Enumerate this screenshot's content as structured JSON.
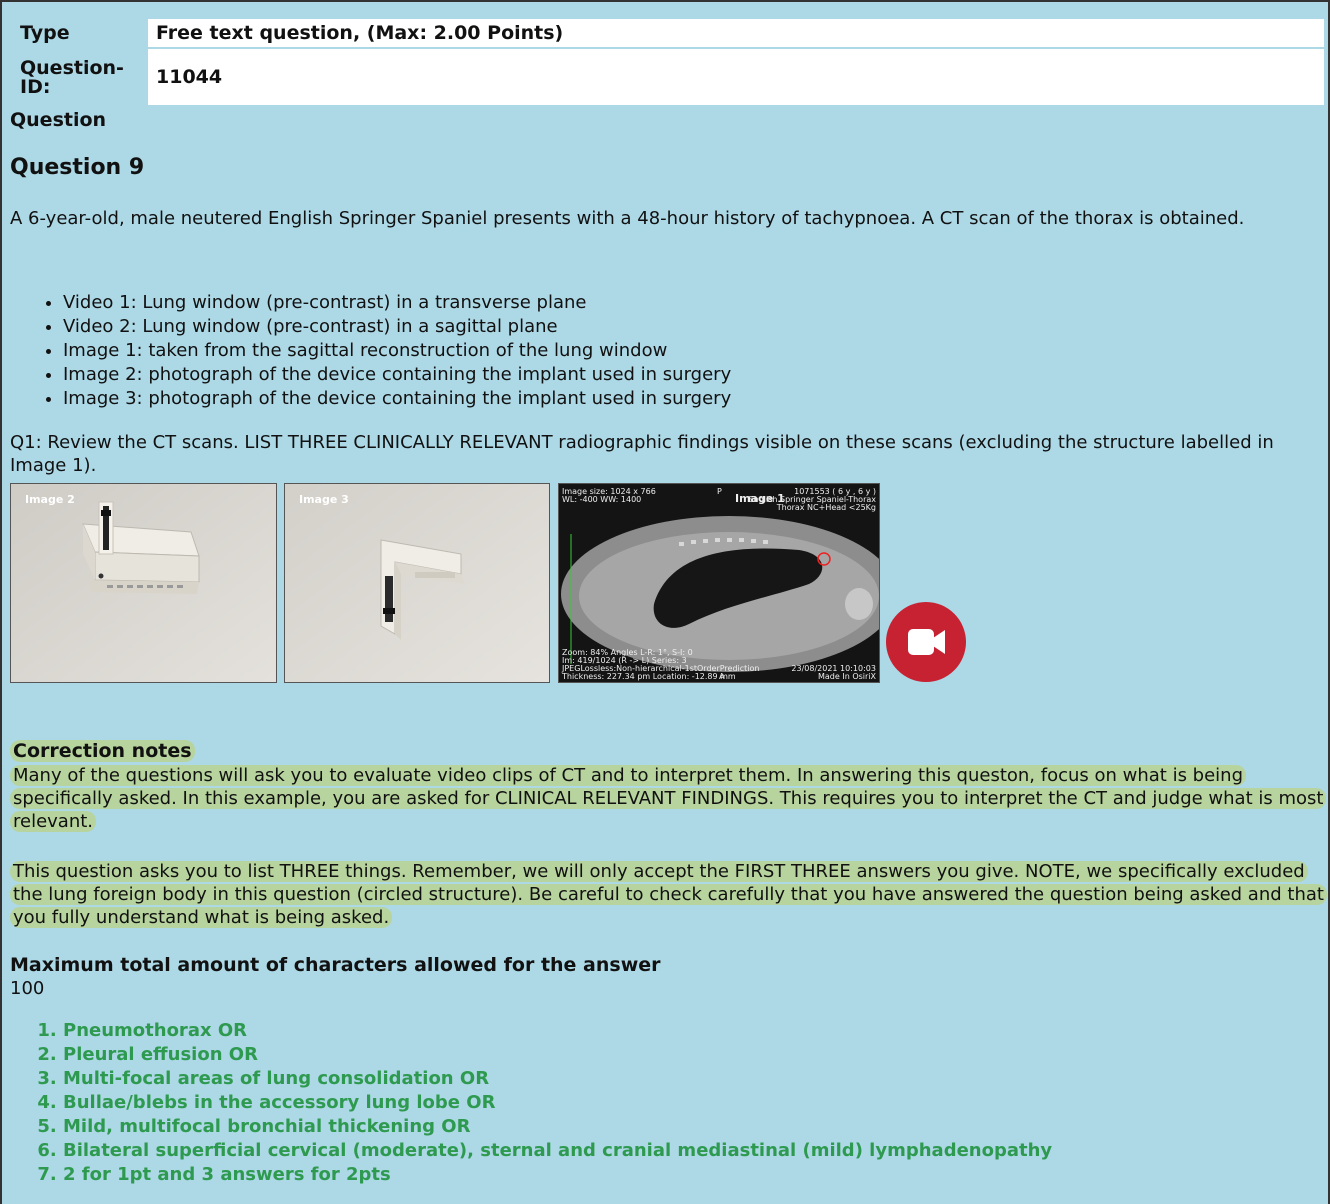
{
  "meta": {
    "type_label": "Type",
    "type_value": "Free text question, (Max: 2.00 Points)",
    "id_label": "Question-\nID:",
    "id_value": "11044"
  },
  "question_label": "Question",
  "question_title": "Question 9",
  "intro": "A 6-year-old, male neutered English Springer Spaniel presents with a 48-hour history of tachypnoea.  A CT scan of the thorax is obtained.",
  "media_list": [
    "Video 1: Lung window (pre-contrast) in a transverse plane",
    "Video 2: Lung window (pre-contrast) in a sagittal plane",
    "Image 1: taken from the sagittal reconstruction of the lung window",
    "Image 2: photograph of the device containing the implant used in surgery",
    "Image 3: photograph of the device containing the implant used in surgery"
  ],
  "q1_text": "Q1: Review the CT scans.  LIST THREE CLINICALLY RELEVANT radiographic findings visible on these scans (excluding the structure labelled in Image 1).",
  "images": {
    "img2_label": "Image 2",
    "img3_label": "Image 3",
    "ct": {
      "title": "Image 1",
      "top_left_1": "Image size: 1024 x 766",
      "top_left_2": "WL: -400 WW: 1400",
      "top_center": "P",
      "top_right_1": "1071553 ( 6 y , 6 y )",
      "top_right_2": "English Springer Spaniel-Thorax",
      "top_right_3": "Thorax NC+Head <25Kg",
      "bottom_left_1": "Zoom: 84% Angles L-R: 1°, S-I: 0",
      "bottom_left_2": "Im: 419/1024  (R -> L) Series: 3",
      "bottom_left_3": "JPEGLossless:Non-hierarchical-1stOrderPrediction",
      "bottom_left_4": "Thickness: 227.34 pm Location: -12.89 mm",
      "bottom_center": "A",
      "bottom_right_1": "23/08/2021 10:10:03",
      "bottom_right_2": "Made In OsiriX"
    },
    "video_icon": "video-camera-icon"
  },
  "correction": {
    "label": "Correction notes",
    "p1": "Many of the questions will ask you to evaluate video clips of CT and to interpret them. In answering this queston, focus on what is being specifically asked. In this example, you are asked for CLINICAL RELEVANT FINDINGS. This requires you to interpret the CT and judge what is most relevant.",
    "p2": "This question asks you to list THREE things. Remember, we will only accept the FIRST THREE answers you give. NOTE, we specifically excluded the lung foreign body in this question (circled structure). Be careful to check carefully that you have answered the question being asked and that you fully understand what is being asked."
  },
  "max_chars": {
    "label": "Maximum total amount of characters allowed for the answer",
    "value": "100"
  },
  "answers": [
    "Pneumothorax OR",
    "Pleural effusion OR",
    "Multi-focal areas of lung consolidation OR",
    "Bullae/blebs in the accessory lung lobe OR",
    "Mild, multifocal bronchial thickening OR",
    "Bilateral superficial cervical (moderate), sternal and cranial mediastinal (mild) lymphadenopathy",
    "2 for 1pt and 3 answers for 2pts"
  ],
  "colors": {
    "background": "#add8e6",
    "highlight": "#b7d39e",
    "answer_green": "#2e9a4f",
    "video_red": "#c62232"
  }
}
